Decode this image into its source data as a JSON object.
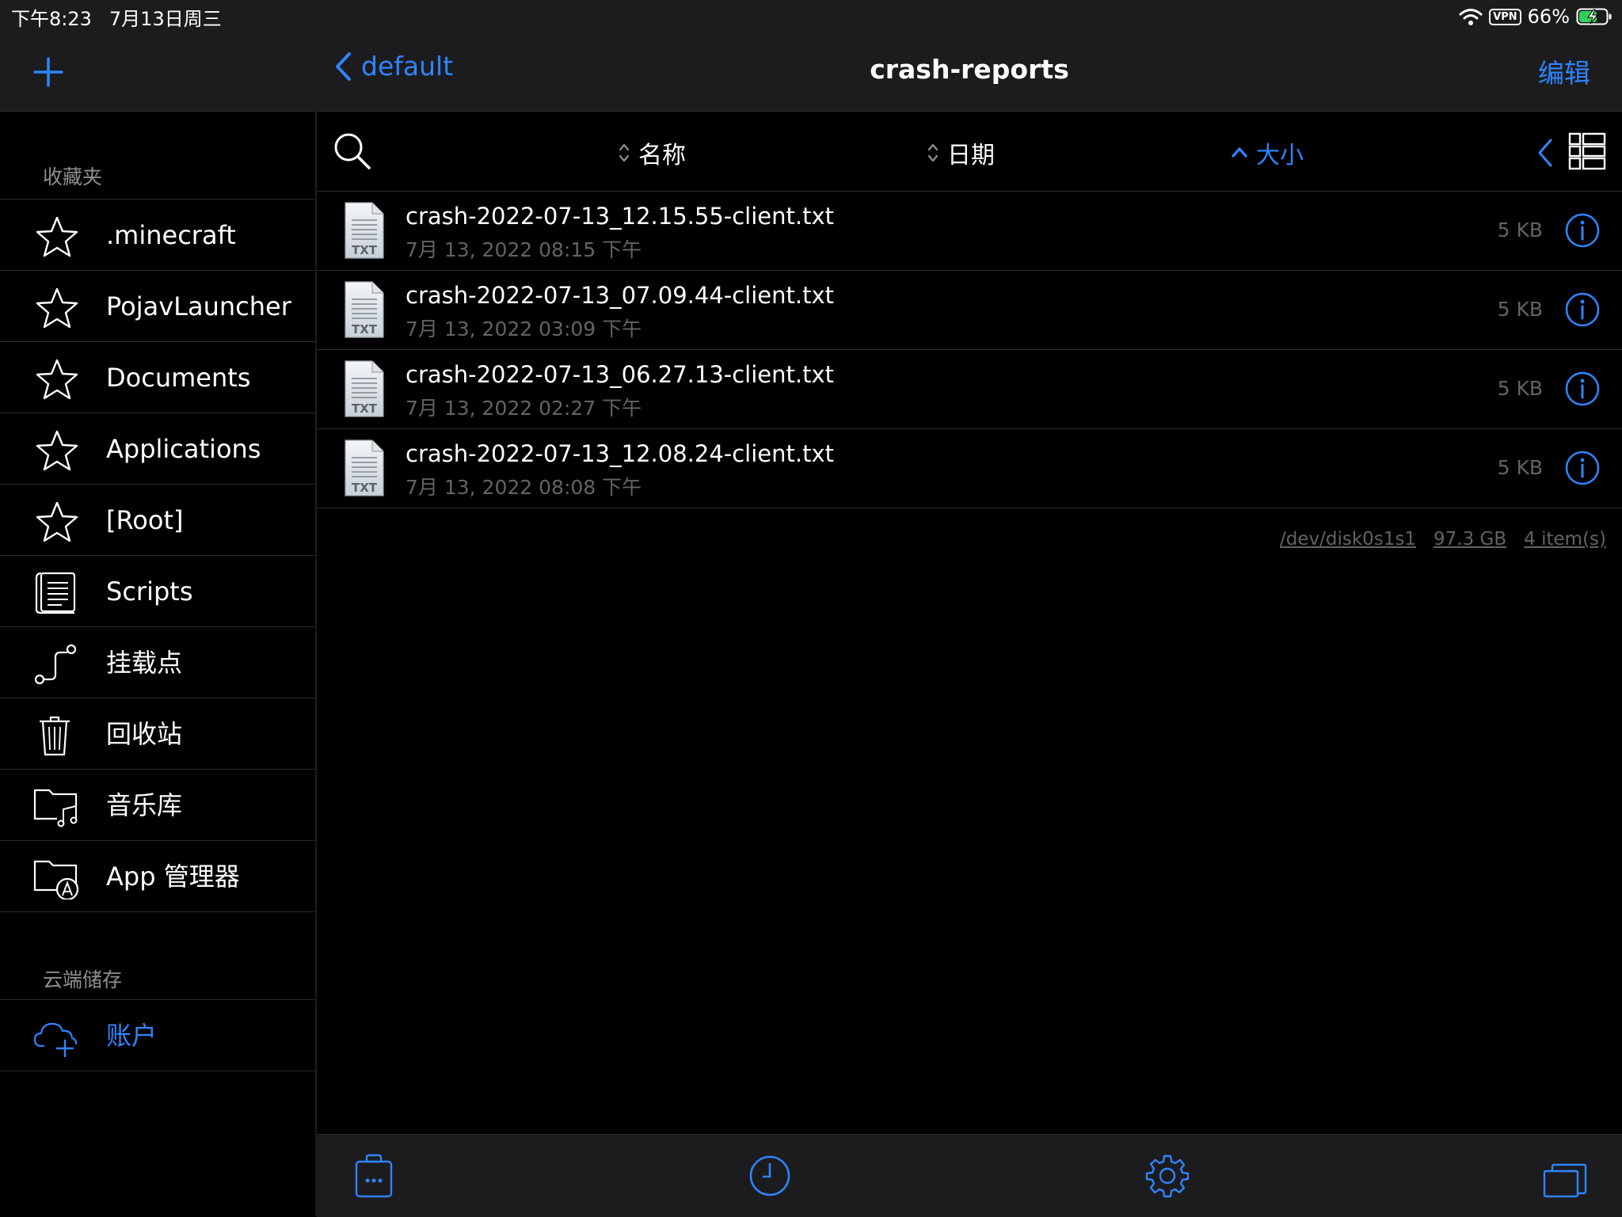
{
  "status_bar": {
    "time": "下午8:23",
    "date": "7月13日周三",
    "vpn": "VPN",
    "battery": "66%"
  },
  "sidebar": {
    "favorites_title": "收藏夹",
    "favorites": [
      {
        "label": ".minecraft",
        "icon": "star-icon"
      },
      {
        "label": "PojavLauncher",
        "icon": "star-icon"
      },
      {
        "label": "Documents",
        "icon": "star-icon"
      },
      {
        "label": "Applications",
        "icon": "star-icon"
      },
      {
        "label": "[Root]",
        "icon": "star-icon"
      },
      {
        "label": "Scripts",
        "icon": "scroll-icon"
      },
      {
        "label": "挂载点",
        "icon": "mount-icon"
      },
      {
        "label": "回收站",
        "icon": "trash-icon"
      },
      {
        "label": "音乐库",
        "icon": "music-folder-icon"
      },
      {
        "label": "App 管理器",
        "icon": "app-folder-icon"
      }
    ],
    "cloud_title": "云端储存",
    "cloud": [
      {
        "label": "账户",
        "icon": "cloud-add-icon"
      }
    ]
  },
  "nav": {
    "back_label": "default",
    "title": "crash-reports",
    "edit_label": "编辑"
  },
  "toolbar": {
    "sort_name": "名称",
    "sort_date": "日期",
    "sort_size": "大小",
    "active_sort": "size"
  },
  "files": [
    {
      "name": "crash-2022-07-13_12.15.55-client.txt",
      "date": "7月 13, 2022 08:15 下午",
      "size": "5 KB",
      "type": "TXT"
    },
    {
      "name": "crash-2022-07-13_07.09.44-client.txt",
      "date": "7月 13, 2022 03:09 下午",
      "size": "5 KB",
      "type": "TXT"
    },
    {
      "name": "crash-2022-07-13_06.27.13-client.txt",
      "date": "7月 13, 2022 02:27 下午",
      "size": "5 KB",
      "type": "TXT"
    },
    {
      "name": "crash-2022-07-13_12.08.24-client.txt",
      "date": "7月 13, 2022 08:08 下午",
      "size": "5 KB",
      "type": "TXT"
    }
  ],
  "footer": {
    "device": "/dev/disk0s1s1",
    "free_space": "97.3 GB",
    "items": "4 item(s)"
  },
  "colors": {
    "accent": "#2f84ff",
    "background": "#000000",
    "panel": "#1c1c1e",
    "secondary_text": "#636366",
    "battery_fill": "#30d158"
  }
}
